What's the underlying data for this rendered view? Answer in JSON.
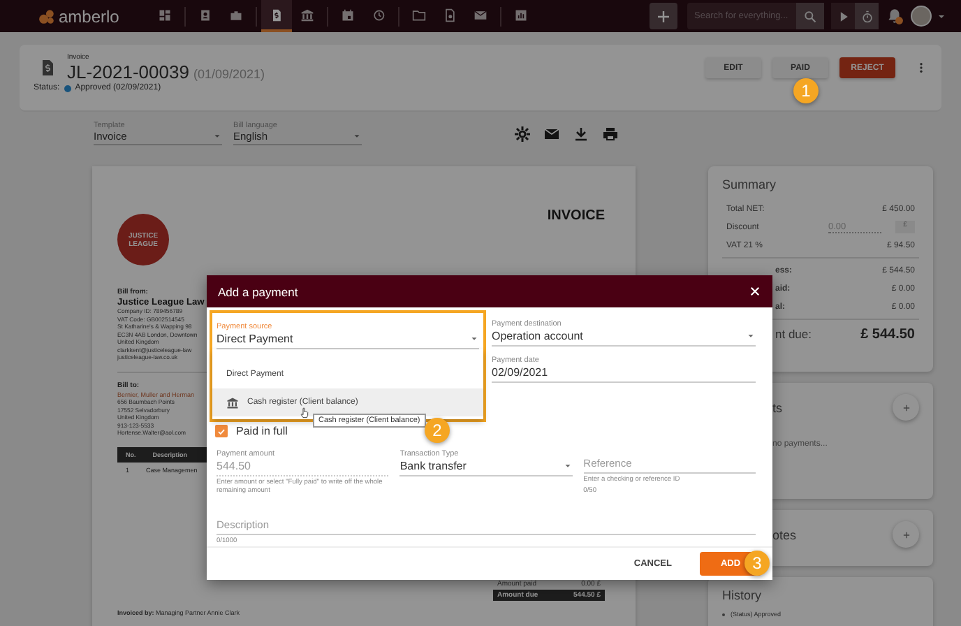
{
  "topbar": {
    "logo": "amberlo",
    "nav": [
      {
        "selected": false
      },
      {
        "selected": false
      },
      {
        "selected": false
      },
      {
        "selected": true
      },
      {
        "selected": false
      },
      {
        "selected": false
      },
      {
        "selected": false
      },
      {
        "selected": false
      },
      {
        "selected": false
      },
      {
        "selected": false
      },
      {
        "selected": false
      }
    ],
    "search": {
      "placeholder": "Search for everything..."
    }
  },
  "header": {
    "doc_type": "Invoice",
    "number": "JL-2021-00039",
    "date": "(01/09/2021)",
    "status_label": "Status:",
    "status": "Approved (02/09/2021)",
    "buttons": [
      {
        "label": "EDIT",
        "kind": "plain"
      },
      {
        "label": "PAID",
        "kind": "plain"
      },
      {
        "label": "REJECT",
        "kind": "danger"
      }
    ]
  },
  "options": [
    {
      "label": "Template",
      "value": "Invoice"
    },
    {
      "label": "Bill language",
      "value": "English"
    }
  ],
  "invoice": {
    "logo": "JUSTICE LEAGUE",
    "title": "INVOICE",
    "bill_from": {
      "heading": "Bill from:",
      "name": "Justice League Law",
      "lines": [
        "Company ID: 789456789",
        "VAT Code: GB002514545",
        "St Katharine's & Wapping 98",
        "EC3N 4AB London, Downtown",
        "United Kingdom",
        "clarkkent@justiceleague-law",
        "justiceleague-law.co.uk"
      ]
    },
    "bill_to": {
      "heading": "Bill to:",
      "name": "Bernier, Muller and Herman",
      "lines": [
        "656 Baumbach Points",
        "17552 Selvadorbury",
        "United Kingdom",
        "913-123-5533",
        "Hortense.Walter@aol.com"
      ]
    },
    "table": {
      "columns": [
        "No.",
        "Description"
      ],
      "rows": [
        [
          "1",
          "Case Managemen"
        ]
      ]
    },
    "totals": [
      {
        "label": "Amount paid",
        "value": "0.00 £",
        "highlight": false
      },
      {
        "label": "Amount due",
        "value": "544.50 £",
        "highlight": true
      }
    ],
    "invoiced_by": "**Invoiced by:** Managing Partner Annie Clark"
  },
  "summary": {
    "title": "Summary",
    "rows": [
      {
        "label": "Total NET:",
        "value": "£ 450.00",
        "kind": "line"
      },
      {
        "label": "Discount",
        "value": "0.00",
        "unit": "£",
        "kind": "discount"
      },
      {
        "label": "VAT 21 %",
        "value": "£ 94.50",
        "kind": "line"
      }
    ],
    "totals": [
      {
        "label": "ess:",
        "value": "£ 544.50"
      },
      {
        "label": "aid:",
        "value": "£ 0.00"
      },
      {
        "label": "al:",
        "value": "£ 0.00"
      }
    ],
    "due": {
      "label": "nt due:",
      "value": "£ 544.50"
    }
  },
  "payments": {
    "title": "ts",
    "empty": "no payments..."
  },
  "notes": {
    "title": "otes"
  },
  "history": {
    "title": "History",
    "items": [
      "(Status) Approved"
    ]
  },
  "dialog": {
    "title": "Add a payment",
    "source": {
      "label": "Payment source",
      "value": "Direct Payment",
      "options": [
        {
          "label": "Direct Payment",
          "kind": "plain",
          "highlighted": false
        },
        {
          "label": "Cash register (Client balance)",
          "kind": "bank",
          "highlighted": true
        }
      ],
      "tooltip": "Cash register (Client balance)"
    },
    "destination": {
      "label": "Payment destination",
      "value": "Operation account"
    },
    "date": {
      "label": "Payment date",
      "value": "02/09/2021"
    },
    "paid_in_full": {
      "label": "Paid in full",
      "checked": true
    },
    "amount": {
      "label": "Payment amount",
      "value": "544.50",
      "hint": "Enter amount or select \"Fully paid\" to write off the whole remaining amount"
    },
    "transaction": {
      "label": "Transaction Type",
      "value": "Bank transfer"
    },
    "reference": {
      "placeholder": "Reference",
      "hint": "Enter a checking or reference ID",
      "counter": "0/50"
    },
    "description": {
      "placeholder": "Description",
      "counter": "0/1000"
    },
    "buttons": [
      {
        "label": "CANCEL",
        "kind": "text"
      },
      {
        "label": "ADD",
        "kind": "primary"
      }
    ]
  },
  "markers": [
    "1",
    "2",
    "3"
  ]
}
